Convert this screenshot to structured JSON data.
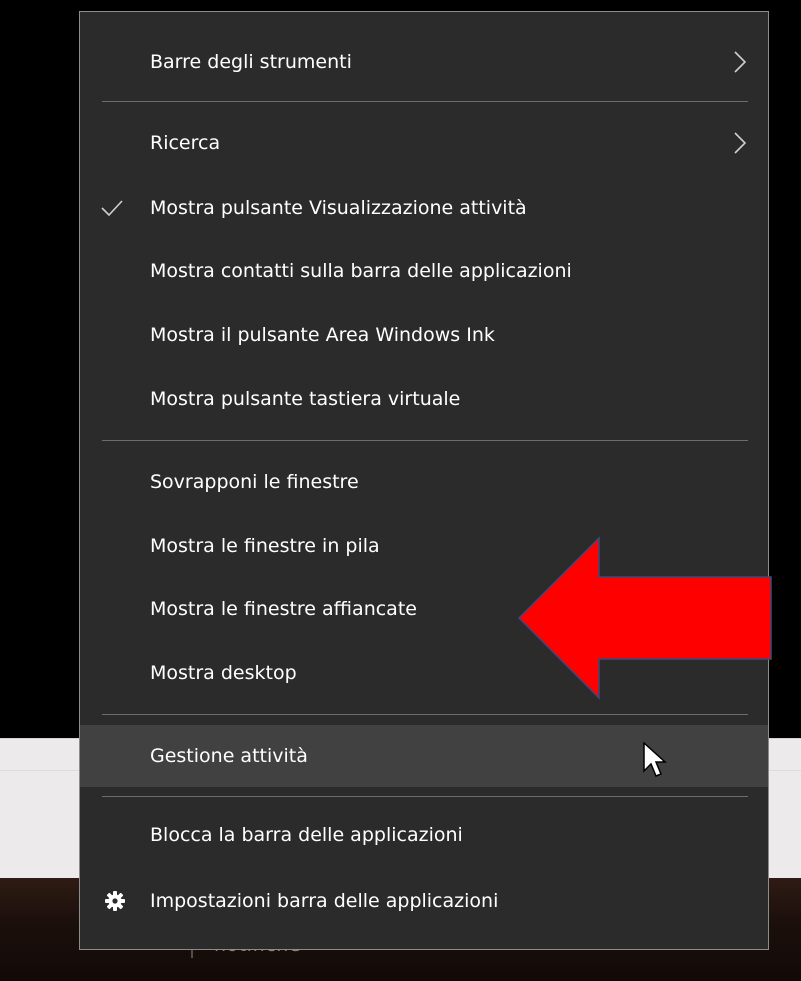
{
  "background": {
    "taskbar_text": "notifiche"
  },
  "menu": {
    "items": [
      {
        "label": "Barre degli strumenti",
        "submenu_icon": "chevron-right-icon"
      },
      {
        "label": "Ricerca",
        "submenu_icon": "chevron-right-icon"
      },
      {
        "label": "Mostra pulsante Visualizzazione attività",
        "checked": true,
        "icon": "checkmark-icon"
      },
      {
        "label": "Mostra contatti sulla barra delle applicazioni"
      },
      {
        "label": "Mostra il pulsante Area Windows Ink"
      },
      {
        "label": "Mostra pulsante tastiera virtuale"
      },
      {
        "label": "Sovrapponi le finestre"
      },
      {
        "label": "Mostra le finestre in pila"
      },
      {
        "label": "Mostra le finestre affiancate",
        "annotation": "red-arrow-icon"
      },
      {
        "label": "Mostra desktop"
      },
      {
        "label": "Gestione attività",
        "hovered": true
      },
      {
        "label": "Blocca la barra delle applicazioni"
      },
      {
        "label": "Impostazioni barra delle applicazioni",
        "icon": "gear-icon"
      }
    ]
  },
  "colors": {
    "menu_background": "#2b2b2b",
    "hover_background": "#414141",
    "text": "#ffffff",
    "annotation_arrow": "#ff0000"
  }
}
